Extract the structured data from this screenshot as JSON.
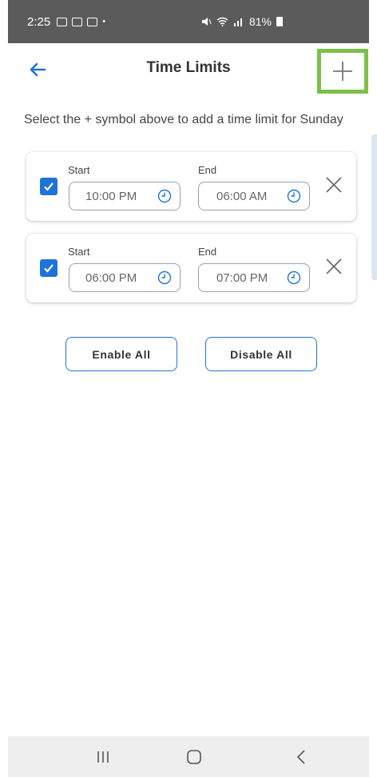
{
  "status_bar": {
    "time": "2:25",
    "right_text": "81%"
  },
  "header": {
    "title": "Time Limits",
    "back_icon": "arrow-left-icon",
    "add_icon": "plus-icon"
  },
  "instruction": "Select the + symbol above to add a time limit for Sunday",
  "time_limits": [
    {
      "checked": true,
      "start_label": "Start",
      "start": "10:00 PM",
      "end_label": "End",
      "end": "06:00 AM"
    },
    {
      "checked": true,
      "start_label": "Start",
      "start": "06:00 PM",
      "end_label": "End",
      "end": "07:00 PM"
    }
  ],
  "buttons": {
    "enable_all": "Enable All",
    "disable_all": "Disable All"
  },
  "colors": {
    "accent": "#1e73d9",
    "highlight": "#7cc04a",
    "status_bar": "#5b5b5b"
  }
}
